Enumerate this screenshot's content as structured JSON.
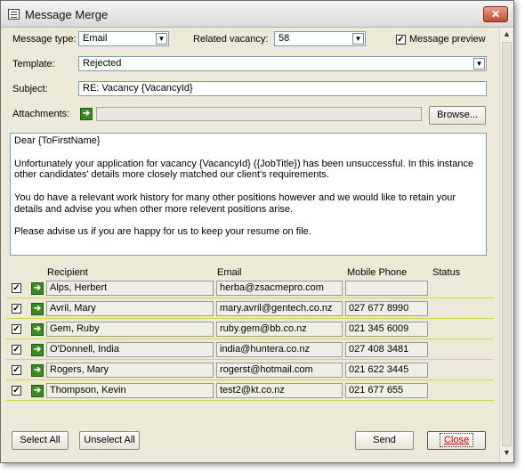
{
  "window": {
    "title": "Message Merge"
  },
  "fields": {
    "message_type_label": "Message type:",
    "message_type_value": "Email",
    "related_vacancy_label": "Related vacancy:",
    "related_vacancy_value": "58",
    "message_preview_label": "Message preview",
    "message_preview_checked": true,
    "template_label": "Template:",
    "template_value": "Rejected",
    "subject_label": "Subject:",
    "subject_value": "RE: Vacancy {VacancyId}",
    "attachments_label": "Attachments:",
    "browse_label": "Browse..."
  },
  "message_body": [
    "Dear {ToFirstName}",
    "",
    "Unfortunately your application for vacancy {VacancyId} ({JobTitle}) has been unsuccessful. In this instance",
    "other candidates'  details more closely matched our client's requirements.",
    "",
    "You do have a relevant work history for many other positions however and we would like to retain your",
    "details and advise you when other more relevent positions arise.",
    "",
    "Please advise us if you are happy for us to keep your resume on file."
  ],
  "grid": {
    "columns": [
      "Recipient",
      "Email",
      "Mobile Phone",
      "Status"
    ],
    "rows": [
      {
        "recipient": "Alps, Herbert",
        "email": "herba@zsacmepro.com",
        "mobile": "",
        "status": "",
        "checked": true
      },
      {
        "recipient": "Avril, Mary",
        "email": "mary.avril@gentech.co.nz",
        "mobile": "027 677 8990",
        "status": "",
        "checked": true
      },
      {
        "recipient": "Gem, Ruby",
        "email": "ruby.gem@bb.co.nz",
        "mobile": "021 345  6009",
        "status": "",
        "checked": true
      },
      {
        "recipient": "O'Donnell, India",
        "email": "india@huntera.co.nz",
        "mobile": "027 408 3481",
        "status": "",
        "checked": true
      },
      {
        "recipient": "Rogers, Mary",
        "email": "rogerst@hotmail.com",
        "mobile": "021 622 3445",
        "status": "",
        "checked": true
      },
      {
        "recipient": "Thompson, Kevin",
        "email": "test2@kt.co.nz",
        "mobile": "021 677 655",
        "status": "",
        "checked": true
      }
    ]
  },
  "buttons": {
    "select_all": "Select All",
    "unselect_all": "Unselect All",
    "send": "Send",
    "close": "Close"
  },
  "icons": {
    "window": "form-icon",
    "close": "close-icon",
    "attachment": "arrow-right-icon",
    "row": "arrow-right-icon",
    "dropdown": "chevron-down-icon"
  }
}
